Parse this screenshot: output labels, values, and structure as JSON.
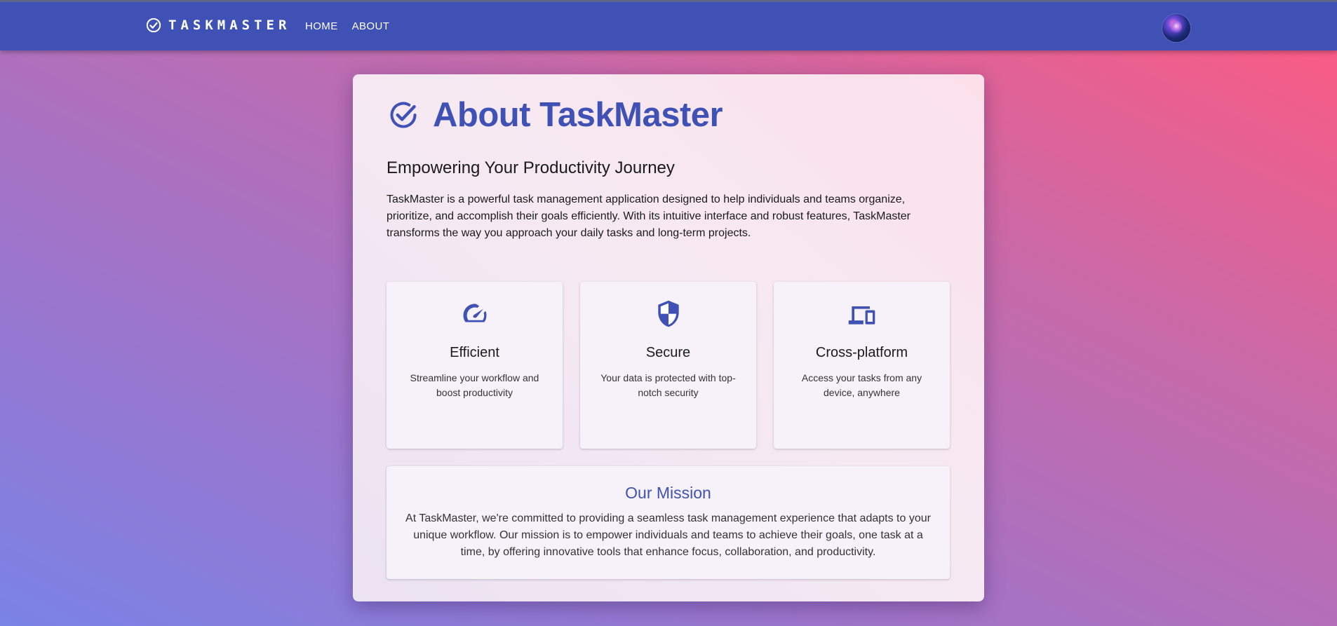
{
  "appbar": {
    "brand": "TASKMASTER",
    "nav": [
      {
        "label": "HOME"
      },
      {
        "label": "ABOUT"
      }
    ]
  },
  "about": {
    "title": "About TaskMaster",
    "subtitle": "Empowering Your Productivity Journey",
    "intro": "TaskMaster is a powerful task management application designed to help individuals and teams organize, prioritize, and accomplish their goals efficiently. With its intuitive interface and robust features, TaskMaster transforms the way you approach your daily tasks and long-term projects.",
    "features": [
      {
        "icon": "speedometer-icon",
        "title": "Efficient",
        "description": "Streamline your workflow and boost productivity"
      },
      {
        "icon": "shield-icon",
        "title": "Secure",
        "description": "Your data is protected with top-notch security"
      },
      {
        "icon": "devices-icon",
        "title": "Cross-platform",
        "description": "Access your tasks from any device, anywhere"
      }
    ],
    "mission": {
      "title": "Our Mission",
      "text": "At TaskMaster, we're committed to providing a seamless task management experience that adapts to your unique workflow. Our mission is to empower individuals and teams to achieve their goals, one task at a time, by offering innovative tools that enhance focus, collaboration, and productivity."
    }
  },
  "colors": {
    "primary": "#3f51b5",
    "appbar": "#3f51b5",
    "gradient_start": "#7a83e6",
    "gradient_end": "#ff5a80"
  }
}
